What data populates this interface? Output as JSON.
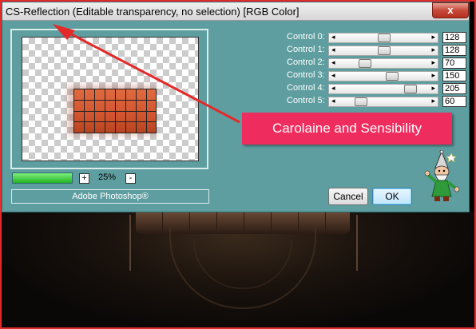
{
  "window": {
    "title": "CS-Reflection (Editable transparency, no selection) [RGB Color]",
    "close_glyph": "x"
  },
  "preview": {
    "zoom_in_glyph": "+",
    "zoom_out_glyph": "-",
    "zoom_value": "25%",
    "progress": 1.0,
    "brand": "Adobe Photoshop®"
  },
  "controls": [
    {
      "label": "Control 0:",
      "value": "128"
    },
    {
      "label": "Control 1:",
      "value": "128"
    },
    {
      "label": "Control 2:",
      "value": "70"
    },
    {
      "label": "Control 3:",
      "value": "150"
    },
    {
      "label": "Control 4:",
      "value": "205"
    },
    {
      "label": "Control 5:",
      "value": "60"
    }
  ],
  "buttons": {
    "cancel": "Cancel",
    "ok": "OK"
  },
  "annotation": {
    "text": "Carolaine and Sensibility"
  },
  "colors": {
    "dialog_bg": "#5f9ea0",
    "annotation_bg": "#ee2d5e",
    "arrow": "#e32a2a",
    "frame": "#e32a2a"
  }
}
